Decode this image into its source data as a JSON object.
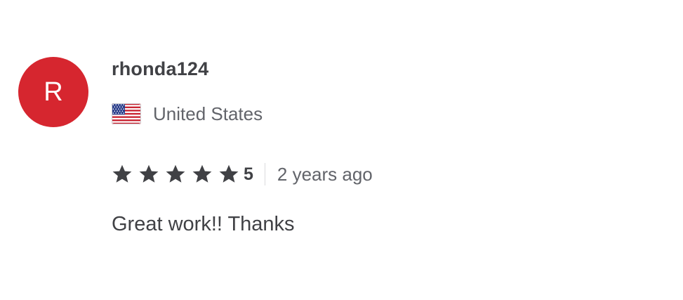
{
  "reviewer": {
    "avatar_initial": "R",
    "avatar_color": "#d6262f",
    "username": "rhonda124",
    "country": "United States",
    "flag_icon": "us-flag-icon"
  },
  "rating": {
    "stars": 5,
    "max_stars": 5,
    "star_color": "#404145",
    "value_label": "5",
    "time_ago": "2 years ago"
  },
  "review": {
    "text": "Great work!! Thanks"
  }
}
